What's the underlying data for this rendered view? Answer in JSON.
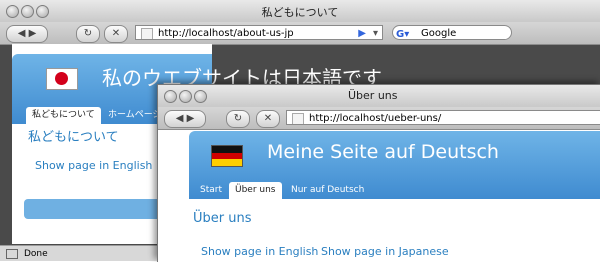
{
  "jp_window": {
    "title": "私どもについて",
    "url": "http://localhost/about-us-jp",
    "search_placeholder": "Google",
    "site_title": "私のウエブサイトは日本語です",
    "tabs": [
      "私どもについて",
      "ホームページ"
    ],
    "heading": "私どもについて",
    "link": "Show page in English",
    "status": "Done"
  },
  "de_window": {
    "title": "Über uns",
    "url": "http://localhost/ueber-uns/",
    "site_title": "Meine Seite auf Deutsch",
    "tabs": [
      "Start",
      "Über uns",
      "Nur auf Deutsch"
    ],
    "heading": "Über uns",
    "links": [
      "Show page in English",
      "Show page in Japanese"
    ]
  },
  "colors": {
    "banner": "#4a97d6",
    "link": "#2a7fc0"
  }
}
